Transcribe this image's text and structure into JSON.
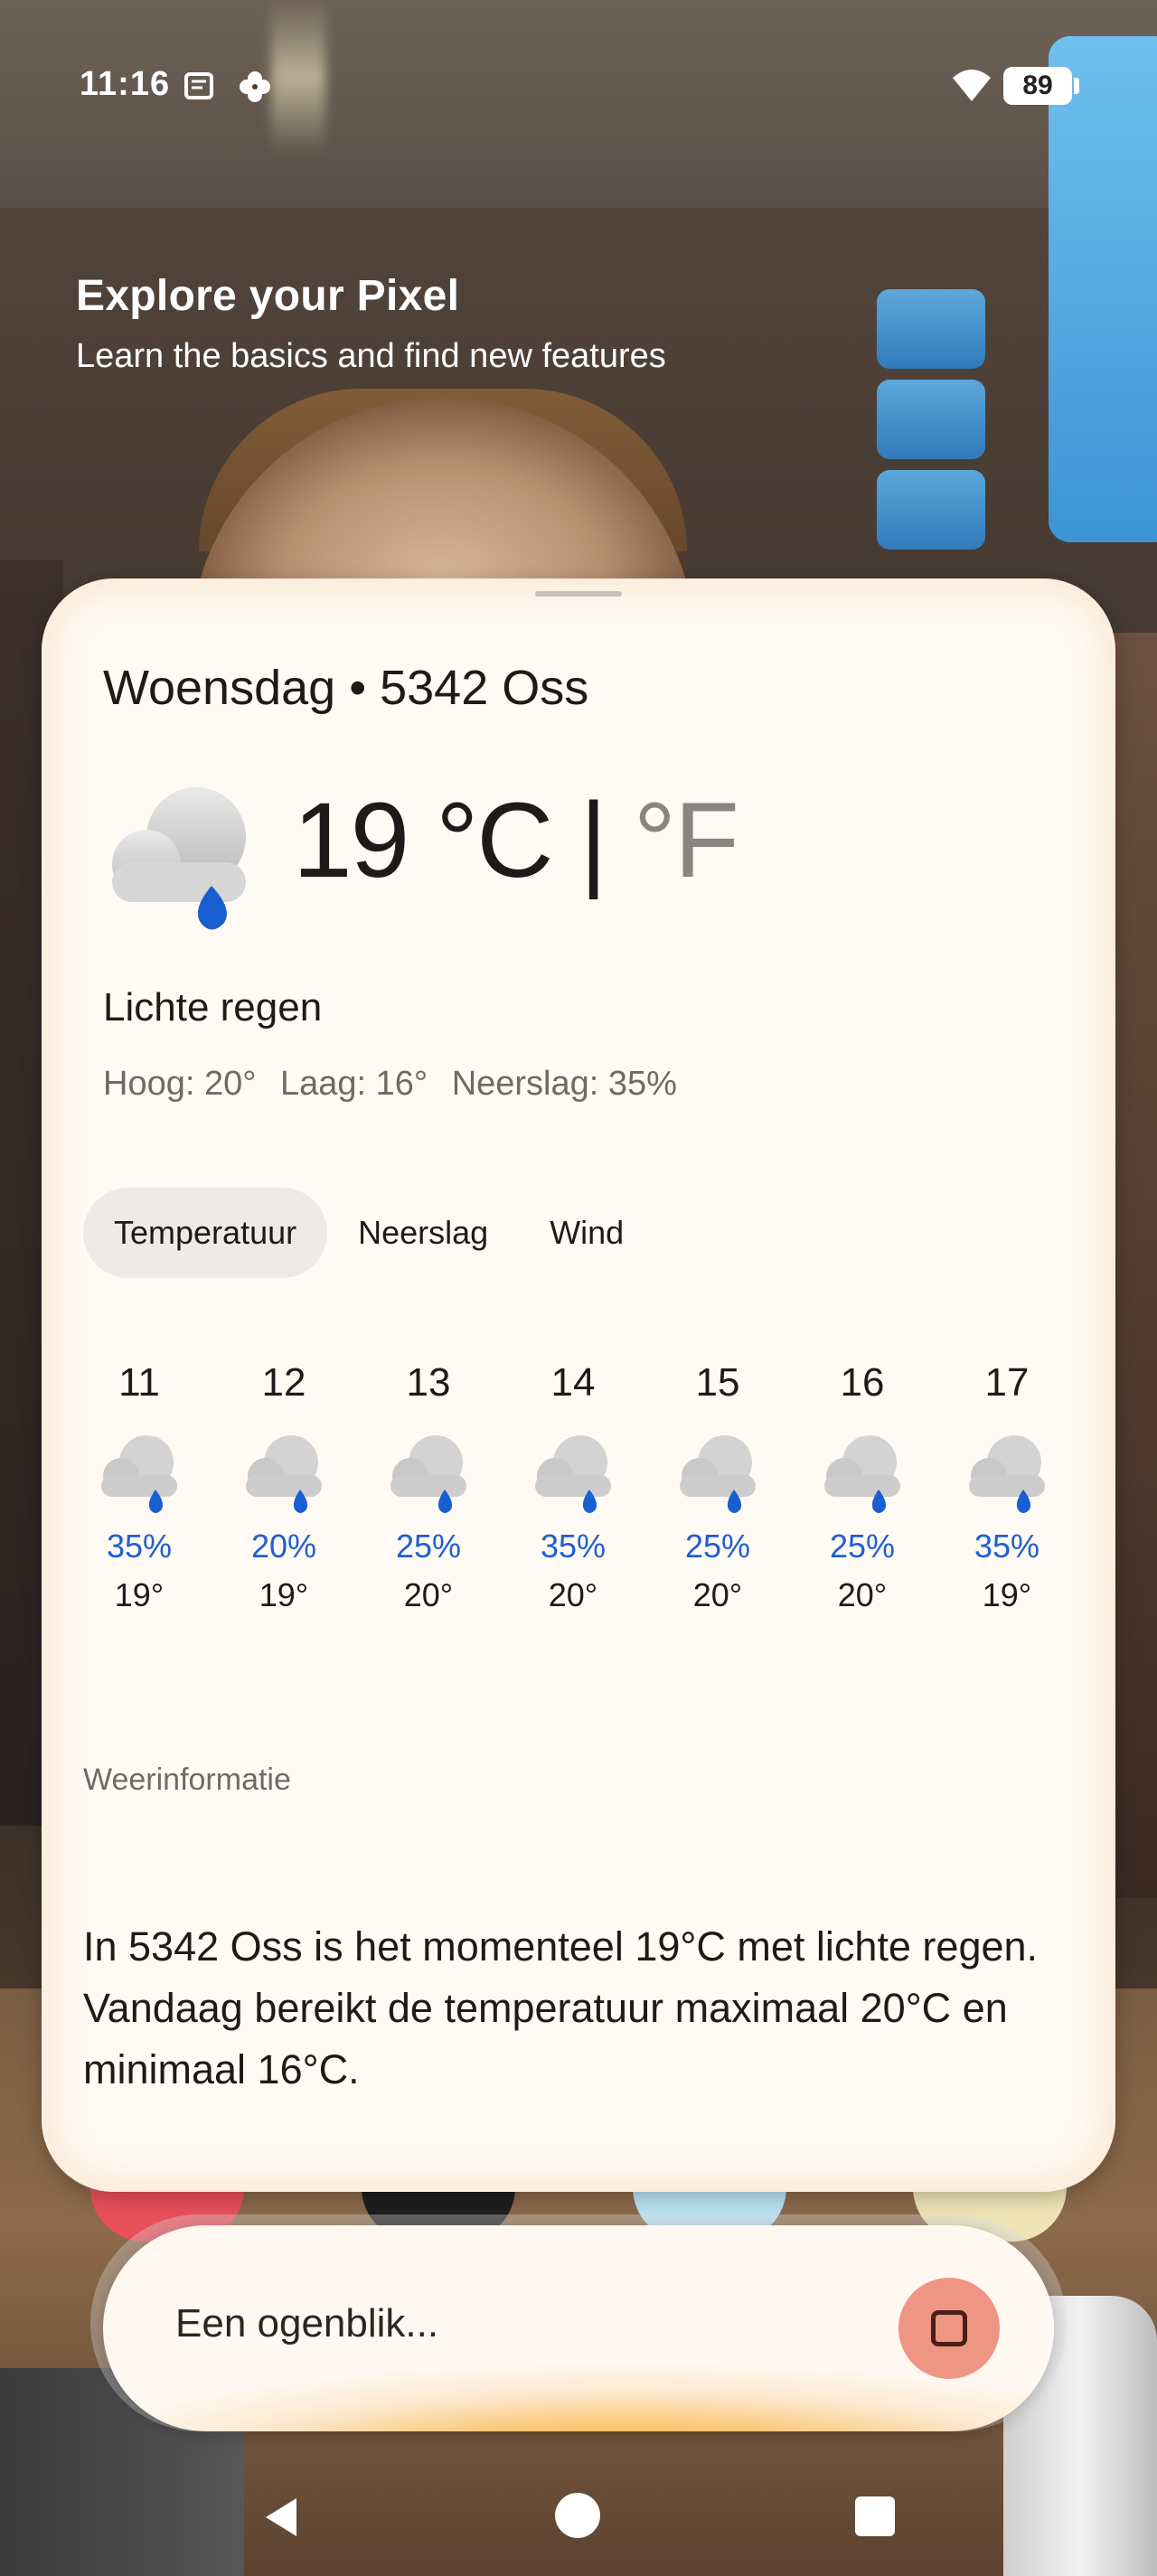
{
  "status_bar": {
    "time": "11:16",
    "battery": "89",
    "icons": [
      "notes-icon",
      "pinwheel-icon",
      "wifi-icon",
      "battery-icon"
    ]
  },
  "header": {
    "title": "Explore your Pixel",
    "subtitle": "Learn the basics and find new features"
  },
  "weather": {
    "location": "Woensdag • 5342 Oss",
    "temperature": "19",
    "unit_c": "°C",
    "separator": "|",
    "unit_f": "°F",
    "condition": "Lichte regen",
    "high": "Hoog: 20°",
    "low": "Laag: 16°",
    "precip": "Neerslag: 35%",
    "icon": "light-rain-icon"
  },
  "tabs": [
    {
      "label": "Temperatuur",
      "active": true
    },
    {
      "label": "Neerslag",
      "active": false
    },
    {
      "label": "Wind",
      "active": false
    }
  ],
  "forecast": [
    {
      "hour": "11",
      "precip": "35%",
      "temp": "19°"
    },
    {
      "hour": "12",
      "precip": "20%",
      "temp": "19°"
    },
    {
      "hour": "13",
      "precip": "25%",
      "temp": "20°"
    },
    {
      "hour": "14",
      "precip": "35%",
      "temp": "20°"
    },
    {
      "hour": "15",
      "precip": "25%",
      "temp": "20°"
    },
    {
      "hour": "16",
      "precip": "25%",
      "temp": "20°"
    },
    {
      "hour": "17",
      "precip": "35%",
      "temp": "19°"
    }
  ],
  "info": {
    "label": "Weerinformatie",
    "text": "In 5342 Oss is het momenteel 19°C met lichte regen. Vandaag bereikt de temperatuur maximaal 20°C en minimaal 16°C."
  },
  "assistant": {
    "status_text": "Een ogenblik...",
    "stop_icon": "stop-icon"
  },
  "colors": {
    "precip_blue": "#1f5fcf",
    "assistant_orange": "#f7a51e",
    "stop_button": "#ef9583"
  }
}
